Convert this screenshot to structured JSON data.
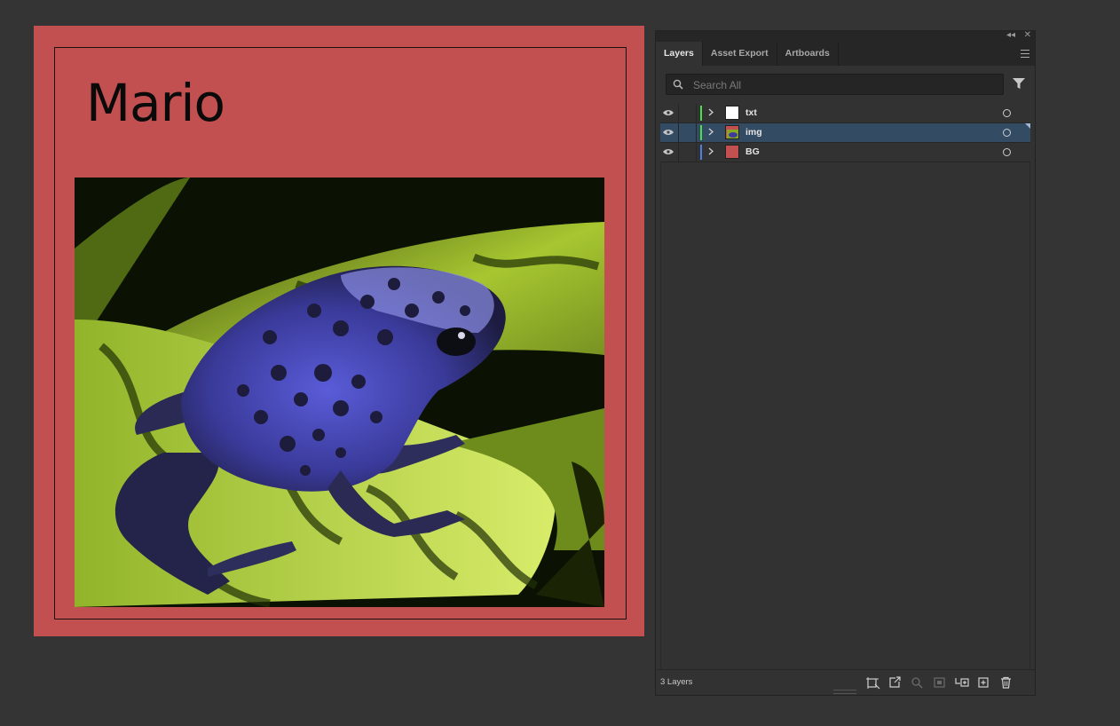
{
  "artboard": {
    "title": "Mario",
    "background": "#c25050",
    "image": "blue poison dart frog on green leaf"
  },
  "panel": {
    "tabs": [
      {
        "label": "Layers",
        "active": true
      },
      {
        "label": "Asset Export",
        "active": false
      },
      {
        "label": "Artboards",
        "active": false
      }
    ],
    "search": {
      "placeholder": "Search All",
      "value": ""
    },
    "layers": [
      {
        "name": "txt",
        "color": "#4cdc4c",
        "selected": false,
        "visible": true,
        "thumb": "white-page"
      },
      {
        "name": "img",
        "color": "#4cdc4c",
        "selected": true,
        "visible": true,
        "thumb": "frog-image"
      },
      {
        "name": "BG",
        "color": "#4f7fe0",
        "selected": false,
        "visible": true,
        "thumb": "red-swatch"
      }
    ],
    "layer_count": "3 Layers",
    "footer_tools": [
      "collect-for-export-icon",
      "export-icon",
      "locate-object-icon",
      "make-clipping-mask-icon",
      "create-sublayer-icon",
      "create-new-layer-icon",
      "delete-icon"
    ],
    "accent": "#344b64"
  }
}
